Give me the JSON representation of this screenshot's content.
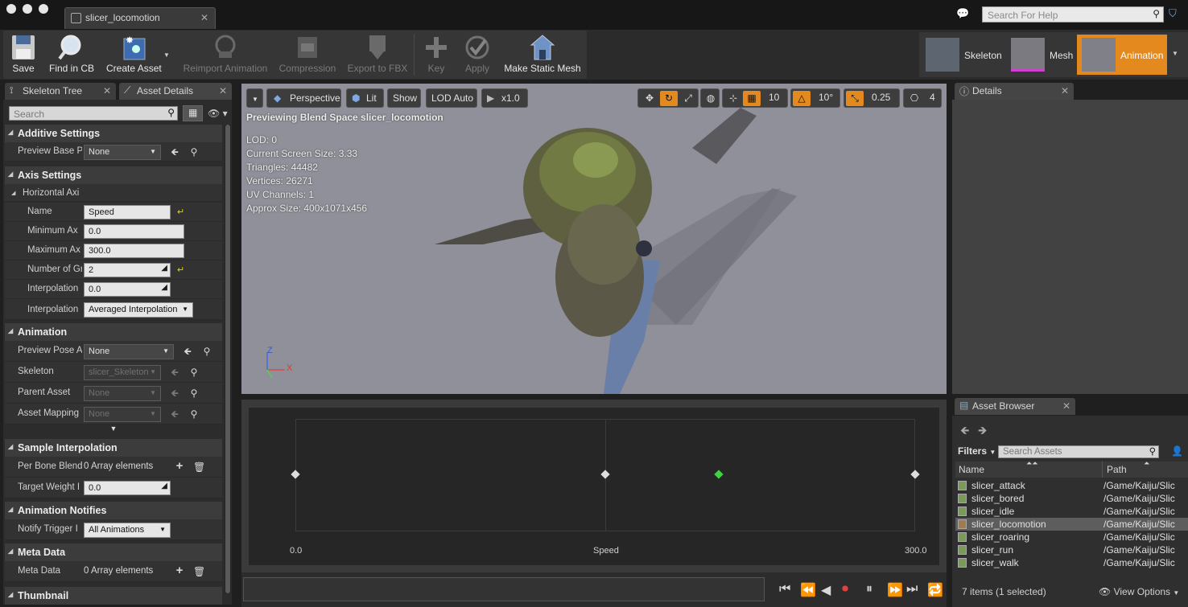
{
  "window": {
    "tab_title": "slicer_locomotion",
    "help_search_placeholder": "Search For Help"
  },
  "toolbar": {
    "save": "Save",
    "find_in_cb": "Find in CB",
    "create_asset": "Create Asset",
    "reimport": "Reimport Animation",
    "compression": "Compression",
    "export_fbx": "Export to FBX",
    "key": "Key",
    "apply": "Apply",
    "make_static_mesh": "Make Static Mesh"
  },
  "modes": {
    "skeleton": "Skeleton",
    "mesh": "Mesh",
    "animation": "Animation",
    "active_color": "#e3891e"
  },
  "left_tabs": {
    "skeleton_tree": "Skeleton Tree",
    "asset_details": "Asset Details"
  },
  "left_search": {
    "placeholder": "Search"
  },
  "details_panel": {
    "additive_settings": "Additive Settings",
    "preview_base_label": "Preview Base P",
    "preview_base_value": "None",
    "axis_settings": "Axis Settings",
    "horizontal_axis": "Horizontal Axi",
    "name_label": "Name",
    "name_value": "Speed",
    "min_label": "Minimum Ax",
    "min_value": "0.0",
    "max_label": "Maximum Ax",
    "max_value": "300.0",
    "grid_label": "Number of Gr",
    "grid_value": "2",
    "interp_label": "Interpolation",
    "interp_value": "0.0",
    "interp_type_label": "Interpolation",
    "interp_type_value": "Averaged Interpolation",
    "animation": "Animation",
    "preview_pose_label": "Preview Pose A",
    "preview_pose_value": "None",
    "skeleton_label": "Skeleton",
    "skeleton_value": "slicer_Skeleton",
    "parent_label": "Parent Asset",
    "parent_value": "None",
    "mapping_label": "Asset Mapping",
    "mapping_value": "None",
    "sample_interp": "Sample Interpolation",
    "per_bone_label": "Per Bone Blend",
    "per_bone_value": "0 Array elements",
    "target_weight_label": "Target Weight I",
    "target_weight_value": "0.0",
    "anim_notifies": "Animation Notifies",
    "notify_label": "Notify Trigger I",
    "notify_value": "All Animations",
    "meta_data": "Meta Data",
    "meta_label": "Meta Data",
    "meta_value": "0 Array elements",
    "thumbnail": "Thumbnail"
  },
  "viewport": {
    "perspective": "Perspective",
    "lit": "Lit",
    "show": "Show",
    "lod": "LOD Auto",
    "speed": "x1.0",
    "grid_snap": "10",
    "rot_snap": "10°",
    "scale_snap": "0.25",
    "cam_speed": "4",
    "header": "Previewing Blend Space slicer_locomotion",
    "lod_info": "LOD: 0",
    "screen_size": "Current Screen Size: 3.33",
    "triangles": "Triangles: 44482",
    "vertices": "Vertices: 26271",
    "uv_channels": "UV Channels: 1",
    "approx_size": "Approx Size: 400x1071x456",
    "axis_z": "Z",
    "axis_x": "X"
  },
  "blend_space": {
    "axis_min": "0.0",
    "axis_name": "Speed",
    "axis_max": "300.0",
    "samples": [
      0.0,
      150.0,
      300.0
    ],
    "preview_value": 205
  },
  "details_right": {
    "title": "Details"
  },
  "asset_browser": {
    "title": "Asset Browser",
    "filters": "Filters",
    "search_placeholder": "Search Assets",
    "col_name": "Name",
    "col_path": "Path",
    "items": [
      {
        "name": "slicer_attack",
        "path": "/Game/Kaiju/Slic"
      },
      {
        "name": "slicer_bored",
        "path": "/Game/Kaiju/Slic"
      },
      {
        "name": "slicer_idle",
        "path": "/Game/Kaiju/Slic"
      },
      {
        "name": "slicer_locomotion",
        "path": "/Game/Kaiju/Slic"
      },
      {
        "name": "slicer_roaring",
        "path": "/Game/Kaiju/Slic"
      },
      {
        "name": "slicer_run",
        "path": "/Game/Kaiju/Slic"
      },
      {
        "name": "slicer_walk",
        "path": "/Game/Kaiju/Slic"
      }
    ],
    "footer": "7 items (1 selected)",
    "view_options": "View Options"
  }
}
